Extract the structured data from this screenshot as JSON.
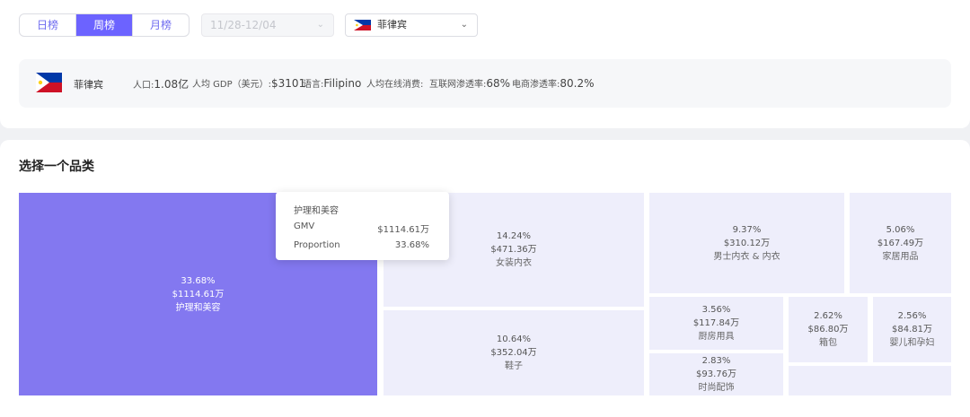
{
  "tabs": {
    "items": [
      "日榜",
      "周榜",
      "月榜"
    ],
    "active": 1
  },
  "date_range": {
    "value": "11/28-12/04",
    "icon": "chevron-down-icon"
  },
  "country_select": {
    "value": "菲律宾",
    "flag_icon": "philippines-flag-icon",
    "icon": "chevron-down-icon"
  },
  "country_info": {
    "name": "菲律宾",
    "population_label": "人口:",
    "population_value": "1.08亿",
    "gdp_label": "人均 GDP（美元）:",
    "gdp_value": "$3101",
    "language_label": "语言:",
    "language_value": "Filipino",
    "online_spend_label": "人均在线消费:",
    "internet_label": "互联网渗透率:",
    "internet_value": "68%",
    "ecommerce_label": "电商渗透率:",
    "ecommerce_value": "80.2%"
  },
  "section_title": "选择一个品类",
  "categories": [
    {
      "name": "护理和美容",
      "percent": "33.68%",
      "gmv": "$1114.61万",
      "selected": true
    },
    {
      "name": "女装内衣",
      "percent": "14.24%",
      "gmv": "$471.36万"
    },
    {
      "name": "鞋子",
      "percent": "10.64%",
      "gmv": "$352.04万"
    },
    {
      "name": "男士内衣 & 内衣",
      "percent": "9.37%",
      "gmv": "$310.12万"
    },
    {
      "name": "家居用品",
      "percent": "5.06%",
      "gmv": "$167.49万"
    },
    {
      "name": "厨房用具",
      "percent": "3.56%",
      "gmv": "$117.84万"
    },
    {
      "name": "箱包",
      "percent": "2.62%",
      "gmv": "$86.80万"
    },
    {
      "name": "婴儿和孕妇",
      "percent": "2.56%",
      "gmv": "$84.81万"
    },
    {
      "name": "时尚配饰",
      "percent": "2.83%",
      "gmv": "$93.76万"
    }
  ],
  "tooltip": {
    "title": "护理和美容",
    "gmv_label": "GMV",
    "gmv_value": "$1114.61万",
    "proportion_label": "Proportion",
    "proportion_value": "33.68%"
  },
  "colors": {
    "accent": "#6c63ff",
    "selected_tile": "#8378f0",
    "tile": "#eeeefb"
  }
}
